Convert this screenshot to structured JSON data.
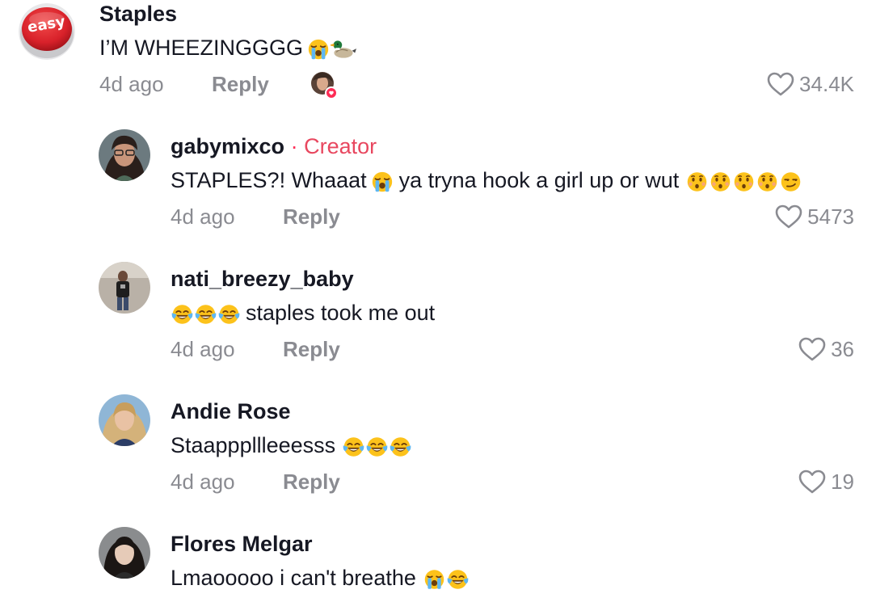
{
  "comments": [
    {
      "username": "Staples",
      "avatar_icon": "easy-button-logo",
      "avatar_text": "easy",
      "text": "I’M WHEEZINGGGG",
      "emoji": [
        "crying-laughing-face",
        "duck"
      ],
      "time": "4d ago",
      "reply_label": "Reply",
      "likes": "34.4K",
      "creator_liked": true
    },
    {
      "username": "gabymixco",
      "creator_dot": "·",
      "creator_label": "Creator",
      "text": "STAPLES?! Whaaat",
      "text_2": "ya tryna hook a girl up or wut",
      "emoji": [
        "loudly-crying-face"
      ],
      "emoji_2": [
        "hushed-face",
        "hushed-face",
        "hushed-face",
        "hushed-face",
        "smirking-face"
      ],
      "time": "4d ago",
      "reply_label": "Reply",
      "likes": "5473"
    },
    {
      "username": "nati_breezy_baby",
      "text": "staples took me out",
      "emoji": [
        "tears-of-joy",
        "tears-of-joy",
        "tears-of-joy"
      ],
      "time": "4d ago",
      "reply_label": "Reply",
      "likes": "36"
    },
    {
      "username": "Andie Rose",
      "text": "Staapppllleeesss",
      "emoji": [
        "tears-of-joy",
        "tears-of-joy",
        "tears-of-joy"
      ],
      "time": "4d ago",
      "reply_label": "Reply",
      "likes": "19"
    },
    {
      "username": "Flores Melgar",
      "text": "Lmaooooo i can't breathe",
      "emoji": [
        "loudly-crying-face",
        "tears-of-joy"
      ],
      "time": "",
      "reply_label": "",
      "likes": ""
    }
  ],
  "colors": {
    "text": "#161823",
    "secondary": "#8a8b91",
    "creator_accent": "#e8475f",
    "easy_button_red": "#d8212a"
  }
}
